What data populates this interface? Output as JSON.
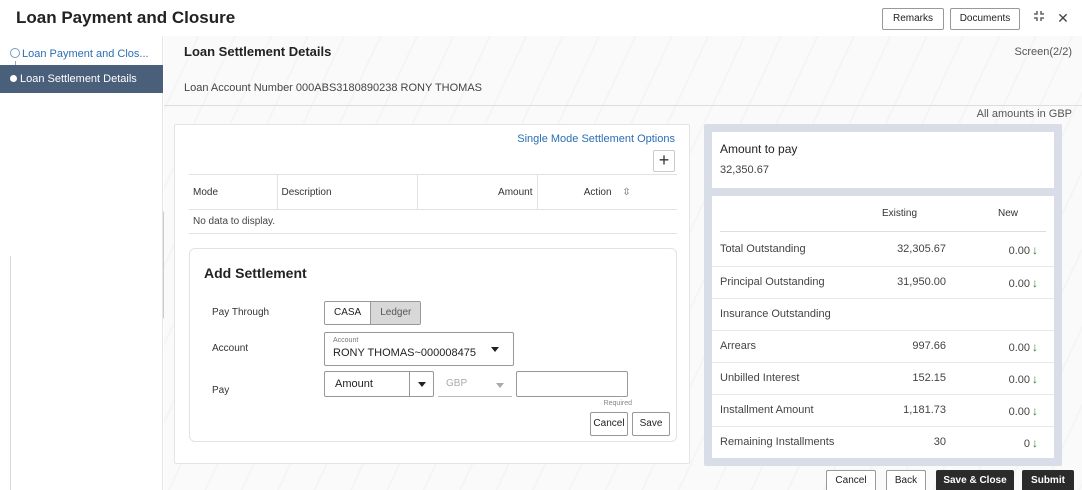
{
  "header": {
    "title": "Loan Payment and Closure",
    "remarks_label": "Remarks",
    "documents_label": "Documents",
    "restore_icon": "↕",
    "close_icon": "✕"
  },
  "sidebar": {
    "steps": [
      {
        "label": "Loan Payment and Clos...",
        "state": "completed"
      },
      {
        "label": "Loan Settlement Details",
        "state": "active"
      }
    ]
  },
  "main": {
    "section_title": "Loan Settlement Details",
    "screen_indicator": "Screen(2/2)",
    "account_label": "Loan Account Number",
    "account_value": "000ABS3180890238 RONY THOMAS",
    "amounts_note": "All amounts in GBP"
  },
  "settlement_grid": {
    "single_mode_link": "Single Mode Settlement Options",
    "add_icon": "+",
    "columns": [
      "Mode",
      "Description",
      "Amount",
      "Action"
    ],
    "sort_icon": "⇳",
    "empty_text": "No data to display."
  },
  "add_settlement": {
    "title": "Add Settlement",
    "pay_through_label": "Pay Through",
    "pay_through_options": [
      "CASA",
      "Ledger"
    ],
    "pay_through_selected": "CASA",
    "account_label": "Account",
    "account_caption": "Account",
    "account_value": "RONY THOMAS~000008475",
    "pay_label": "Pay",
    "pay_type_value": "Amount",
    "currency_placeholder": "GBP",
    "amount_value": "",
    "required_text": "Required",
    "cancel_label": "Cancel",
    "save_label": "Save"
  },
  "summary": {
    "amount_to_pay_label": "Amount to pay",
    "amount_to_pay_value": "32,350.67",
    "col_existing": "Existing",
    "col_new": "New",
    "rows": [
      {
        "label": "Total Outstanding",
        "existing": "32,305.67",
        "new": "0.00"
      },
      {
        "label": "Principal Outstanding",
        "existing": "31,950.00",
        "new": "0.00"
      },
      {
        "label": "Insurance Outstanding",
        "existing": "",
        "new": ""
      },
      {
        "label": "Arrears",
        "existing": "997.66",
        "new": "0.00"
      },
      {
        "label": "Unbilled Interest",
        "existing": "152.15",
        "new": "0.00"
      },
      {
        "label": "Installment Amount",
        "existing": "1,181.73",
        "new": "0.00"
      },
      {
        "label": "Remaining Installments",
        "existing": "30",
        "new": "0"
      }
    ],
    "down_arrow_icon": "↓"
  },
  "footer": {
    "cancel_label": "Cancel",
    "back_label": "Back",
    "save_close_label": "Save & Close",
    "submit_label": "Submit"
  }
}
